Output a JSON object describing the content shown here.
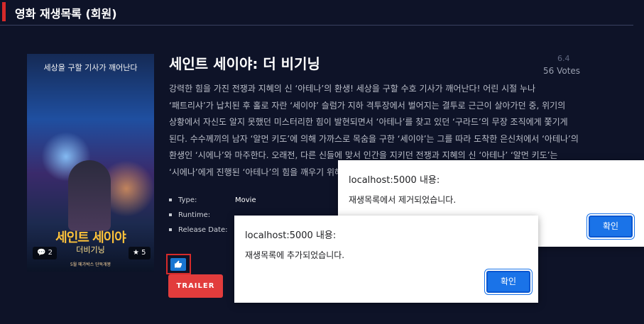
{
  "header": {
    "title": "영화 재생목록 (회원)"
  },
  "movie": {
    "title": "세인트 세이야: 더 비기닝",
    "score": "6.4",
    "votes": "56 Votes",
    "description": "강력한 힘을 가진 전쟁과 지혜의 신 ‘아테나’의 환생! 세상을 구할 수호 기사가 깨어난다! 어린 시절 누나 ‘패트리샤’가 납치된 후 홀로 자란 ‘세이야’ 슬럼가 지하 격투장에서 벌어지는 결투로 근근이 살아가던 중, 위기의 상황에서 자신도 알지 못했던 미스터리한 힘이 발현되면서 ‘아테나’를 찾고 있던 ‘구라드’의 무장 조직에게 쫓기게 된다. 수수께끼의 남자 ‘알먼 키도’에 의해 가까스로 목숨을 구한 ‘세이야’는 그를 따라 도착한 은신처에서 ‘아테나’의 환생인 ‘시에나’와 마주한다. 오래전, 다른 신들에 맞서 인간을 지키던 전쟁과 지혜의 신 ‘아테나’ ‘알먼 키도’는 ‘시에나’에게 진행된 ‘아테나’의 힘을 깨우기 위해 ‘세이야’는 ‘아테나’를 수호하고 세상을 지킬 성투사의 운명을",
    "meta": {
      "type_label": "Type:",
      "type_value": "Movie",
      "runtime_label": "Runtime:",
      "runtime_value": "",
      "release_label": "Release Date:",
      "release_value": ""
    },
    "poster": {
      "tagline": "세상을 구할 기사가 깨어난다",
      "title": "세인트 세이야",
      "subtitle": "더비기닝",
      "release_note": "5월 메가박스 단독개봉",
      "comments_count": "2",
      "rating_count": "5"
    },
    "like_icon": "thumbs-up-icon",
    "trailer_label": "TRAILER"
  },
  "dialogs": [
    {
      "host": "localhost:5000 내용:",
      "message": "재생목록에서 제거되었습니다.",
      "ok_label": "확인"
    },
    {
      "host": "localhost:5000 내용:",
      "message": "재생목록에 추가되었습니다.",
      "ok_label": "확인"
    }
  ],
  "colors": {
    "background": "#0e1328",
    "accent": "#d62a2a",
    "dialog_button": "#1a73e8"
  }
}
